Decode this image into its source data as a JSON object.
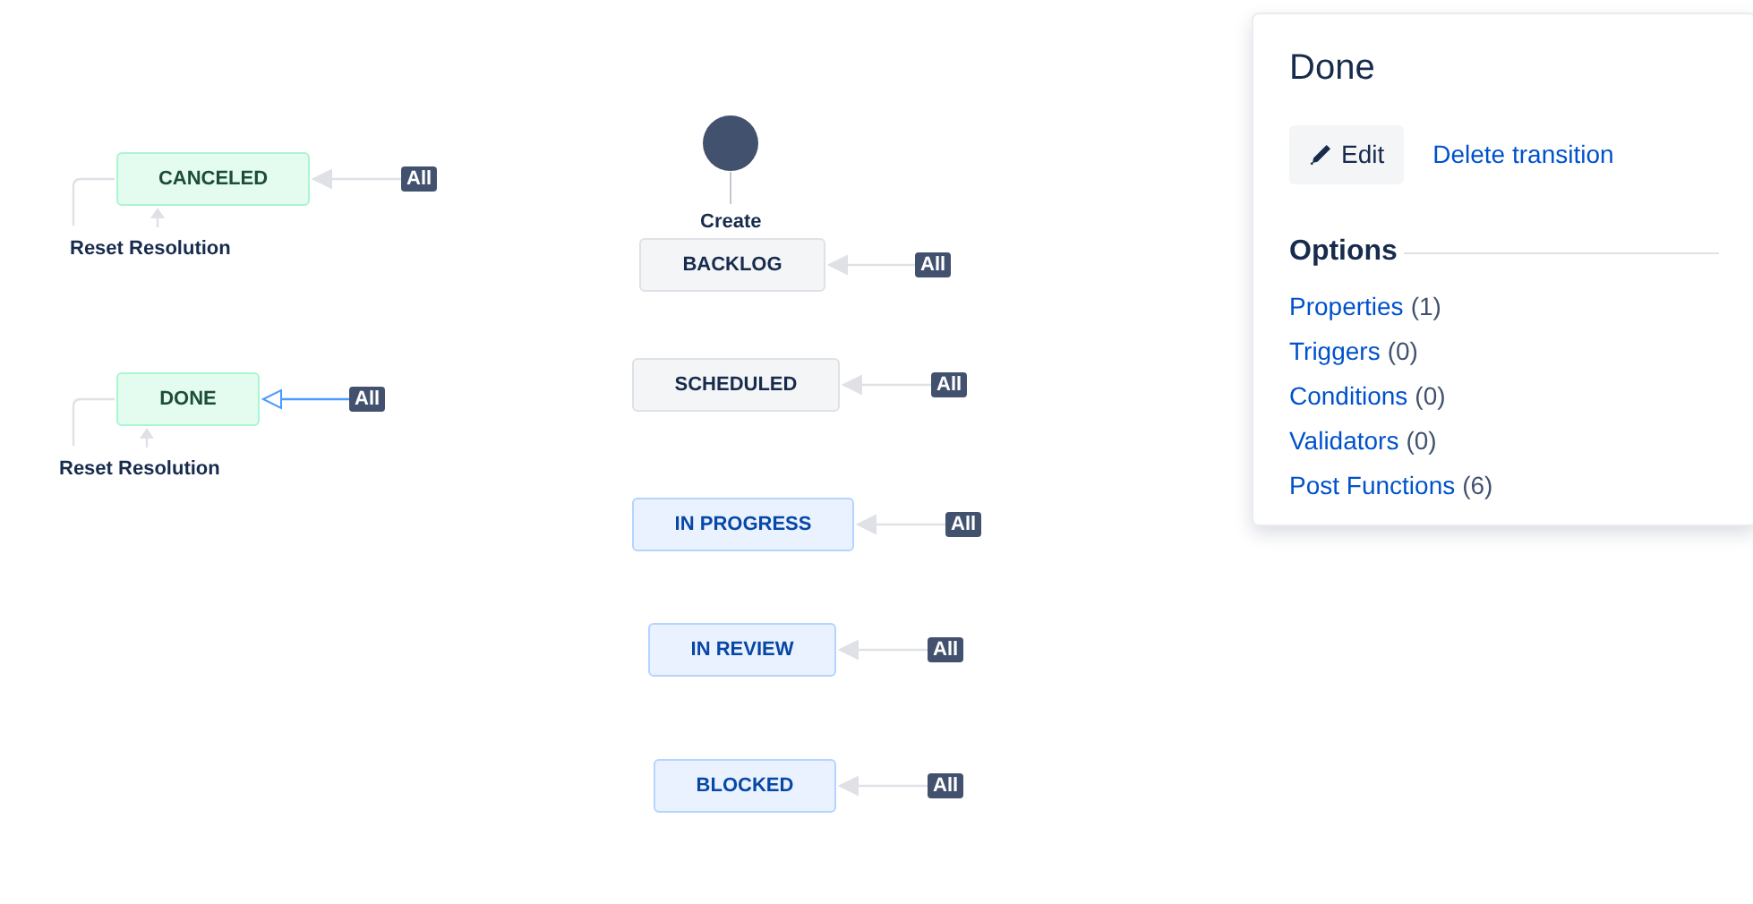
{
  "diagram": {
    "start": {
      "label": "Create"
    },
    "statuses": [
      {
        "name": "CANCELED",
        "kind": "done",
        "global_transition": {
          "label": "All",
          "selected": false
        },
        "loop_label": "Reset Resolution"
      },
      {
        "name": "DONE",
        "kind": "done",
        "global_transition": {
          "label": "All",
          "selected": true
        },
        "loop_label": "Reset Resolution"
      },
      {
        "name": "BACKLOG",
        "kind": "todo",
        "global_transition": {
          "label": "All",
          "selected": false
        }
      },
      {
        "name": "SCHEDULED",
        "kind": "todo",
        "global_transition": {
          "label": "All",
          "selected": false
        }
      },
      {
        "name": "IN PROGRESS",
        "kind": "inprogress",
        "global_transition": {
          "label": "All",
          "selected": false
        }
      },
      {
        "name": "IN REVIEW",
        "kind": "inprogress",
        "global_transition": {
          "label": "All",
          "selected": false
        }
      },
      {
        "name": "BLOCKED",
        "kind": "inprogress",
        "global_transition": {
          "label": "All",
          "selected": false
        }
      }
    ]
  },
  "panel": {
    "title": "Done",
    "edit_button": "Edit",
    "delete_link": "Delete transition",
    "options_heading": "Options",
    "options": [
      {
        "label": "Properties",
        "count": "(1)"
      },
      {
        "label": "Triggers",
        "count": "(0)"
      },
      {
        "label": "Conditions",
        "count": "(0)"
      },
      {
        "label": "Validators",
        "count": "(0)"
      },
      {
        "label": "Post Functions",
        "count": "(6)"
      }
    ]
  }
}
